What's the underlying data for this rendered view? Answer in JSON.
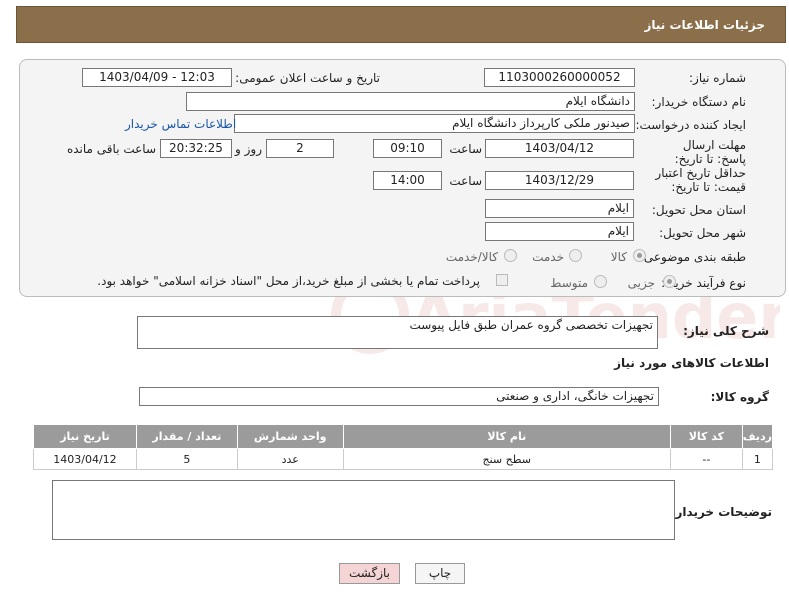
{
  "header": {
    "title": "جزئیات اطلاعات نیاز"
  },
  "form": {
    "need_number_label": "شماره نیاز:",
    "need_number": "1103000260000052",
    "announce_label": "تاریخ و ساعت اعلان عمومی:",
    "announce_value": "1403/04/09 - 12:03",
    "buyer_org_label": "نام دستگاه خریدار:",
    "buyer_org": "دانشگاه ایلام",
    "creator_label": "ایجاد کننده درخواست:",
    "creator": "صیدنور ملکی کارپرداز دانشگاه ایلام",
    "contact_link": "اطلاعات تماس خریدار",
    "deadline_label": "مهلت ارسال پاسخ: تا تاریخ:",
    "deadline_date": "1403/04/12",
    "time_label": "ساعت",
    "deadline_time": "09:10",
    "days_value": "2",
    "days_label": "روز و",
    "remaining_time": "20:32:25",
    "remaining_label": "ساعت باقی مانده",
    "validity_label": "حداقل تاریخ اعتبار قیمت: تا تاریخ:",
    "validity_date": "1403/12/29",
    "validity_time": "14:00",
    "province_label": "استان محل تحویل:",
    "province": "ایلام",
    "city_label": "شهر محل تحویل:",
    "city": "ایلام",
    "category_label": "طبقه بندی موضوعی:",
    "category_options": [
      "کالا",
      "خدمت",
      "کالا/خدمت"
    ],
    "process_label": "نوع فرآیند خرید :",
    "process_options": [
      "جزیی",
      "متوسط"
    ],
    "payment_note": "پرداخت تمام یا بخشی از مبلغ خرید،از محل \"اسناد خزانه اسلامی\" خواهد بود."
  },
  "summary": {
    "label": "شرح کلی نیاز:",
    "value": "تجهیزات تخصصی  گروه عمران طبق  فایل پیوست"
  },
  "goods": {
    "section_title": "اطلاعات کالاهای مورد نیاز",
    "group_label": "گروه کالا:",
    "group_value": "تجهیزات خانگی، اداری و صنعتی",
    "columns": [
      "ردیف",
      "کد کالا",
      "نام کالا",
      "واحد شمارش",
      "تعداد / مقدار",
      "تاریخ نیاز"
    ],
    "rows": [
      [
        "1",
        "--",
        "سطح سنج",
        "عدد",
        "5",
        "1403/04/12"
      ]
    ]
  },
  "notes": {
    "label": "توضیحات خریدار:"
  },
  "buttons": {
    "print": "چاپ",
    "back": "بازگشت"
  },
  "watermark": "AriaTender.neT",
  "colors": {
    "header": "#8b6f4a",
    "table_header": "#9b9b9b",
    "link": "#1a56a8",
    "back_button": "#f4d4d4"
  }
}
